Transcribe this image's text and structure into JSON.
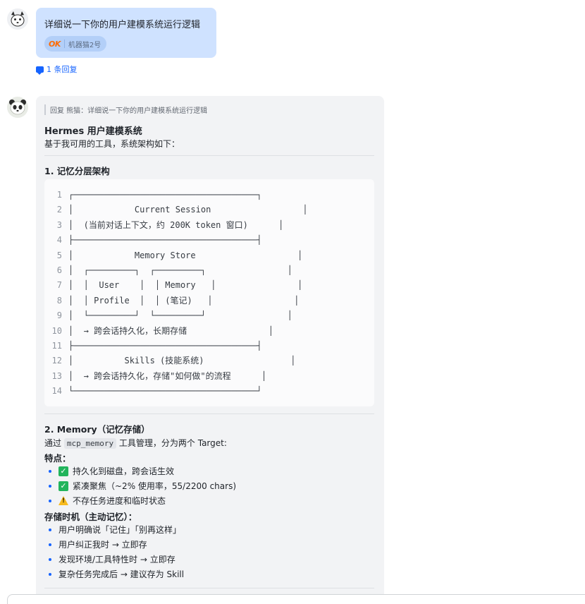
{
  "message1": {
    "text": "详细说一下你的用户建模系统运行逻辑",
    "reaction": {
      "emoji_text": "OK",
      "users": "机器猫2号"
    },
    "reply_count": "1 条回复"
  },
  "message2": {
    "quote": "回复 熊猫：详细说一下你的用户建模系统运行逻辑",
    "title": "Hermes 用户建模系统",
    "intro": "基于我可用的工具，系统架构如下：",
    "section1_title": "1. 记忆分层架构",
    "code_lines": [
      {
        "n": "1",
        "t": "┌────────────────────────────────────┐"
      },
      {
        "n": "2",
        "t": "│            Current Session                  │"
      },
      {
        "n": "3",
        "t": "│  (当前对话上下文，约 200K token 窗口)      │"
      },
      {
        "n": "4",
        "t": "├────────────────────────────────────┤"
      },
      {
        "n": "5",
        "t": "│            Memory Store                    │"
      },
      {
        "n": "6",
        "t": "│  ┌─────────┐  ┌─────────┐                │"
      },
      {
        "n": "7",
        "t": "│  │  User    │  │ Memory   │                │"
      },
      {
        "n": "8",
        "t": "│  │ Profile  │  │ (笔记)   │                │"
      },
      {
        "n": "9",
        "t": "│  └─────────┘  └─────────┘                │"
      },
      {
        "n": "10",
        "t": "│  → 跨会话持久化，长期存储                │"
      },
      {
        "n": "11",
        "t": "├────────────────────────────────────┤"
      },
      {
        "n": "12",
        "t": "│          Skills (技能系统)                 │"
      },
      {
        "n": "13",
        "t": "│  → 跨会话持久化，存储\"如何做\"的流程      │"
      },
      {
        "n": "14",
        "t": "└────────────────────────────────────┘"
      }
    ],
    "section2_title": "2. Memory（记忆存储）",
    "via_prefix": "通过",
    "via_code": "mcp_memory",
    "via_suffix": "工具管理，分为两个 Target:",
    "features_title": "特点：",
    "features": [
      {
        "icon": "check-icon",
        "text": "持久化到磁盘，跨会话生效"
      },
      {
        "icon": "check-icon",
        "text": "紧凑聚焦（~2% 使用率，55/2200 chars)"
      },
      {
        "icon": "warning-icon",
        "text": "不存任务进度和临时状态"
      }
    ],
    "timing_title": "存储时机（主动记忆）：",
    "timing": [
      "用户明确说「记住」「别再这样」",
      "用户纠正我时 → 立即存",
      "发现环境/工具特性时 → 立即存",
      "复杂任务完成后 → 建议存为 Skill"
    ]
  },
  "colors": {
    "accent": "#1664ff",
    "bubble_self": "#cfe2ff",
    "bubble_other": "#f2f3f5",
    "check": "#22b45c",
    "warning": "#f7ba1e"
  }
}
